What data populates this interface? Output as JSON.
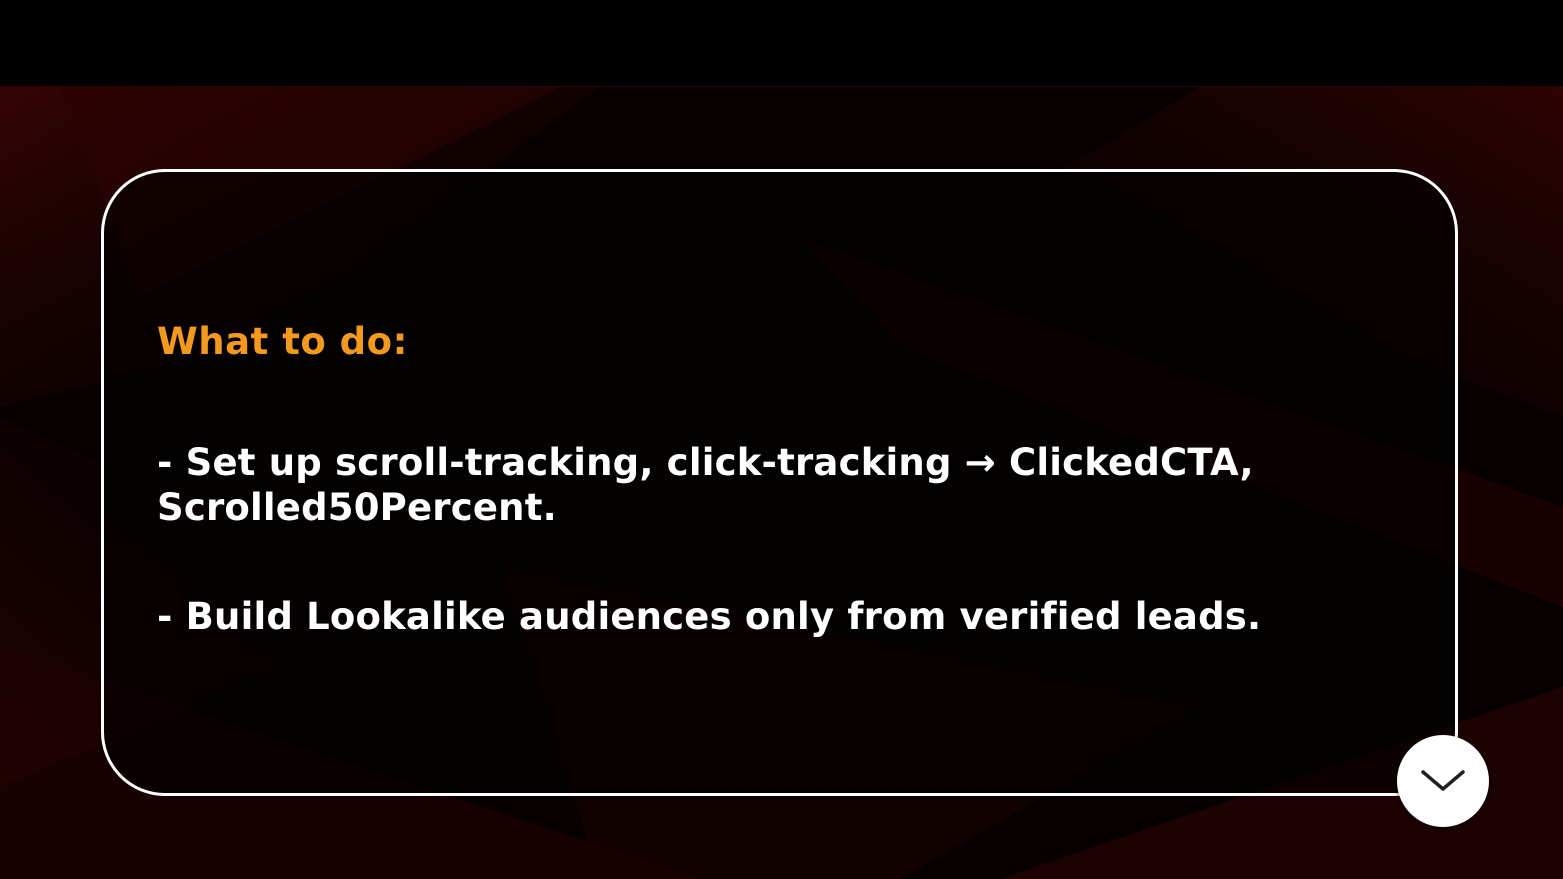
{
  "slide": {
    "heading": "What to do:",
    "bullets": [
      "- Set up scroll-tracking, click-tracking → ClickedCTA, Scrolled50Percent.",
      "- Build Lookalike audiences only from verified leads."
    ]
  },
  "controls": {
    "scroll_down_icon": "chevron-down-icon"
  },
  "colors": {
    "heading": "#f39a1e",
    "text": "#ffffff",
    "background": "#000000",
    "accent_dark_red": "#3a0606"
  }
}
